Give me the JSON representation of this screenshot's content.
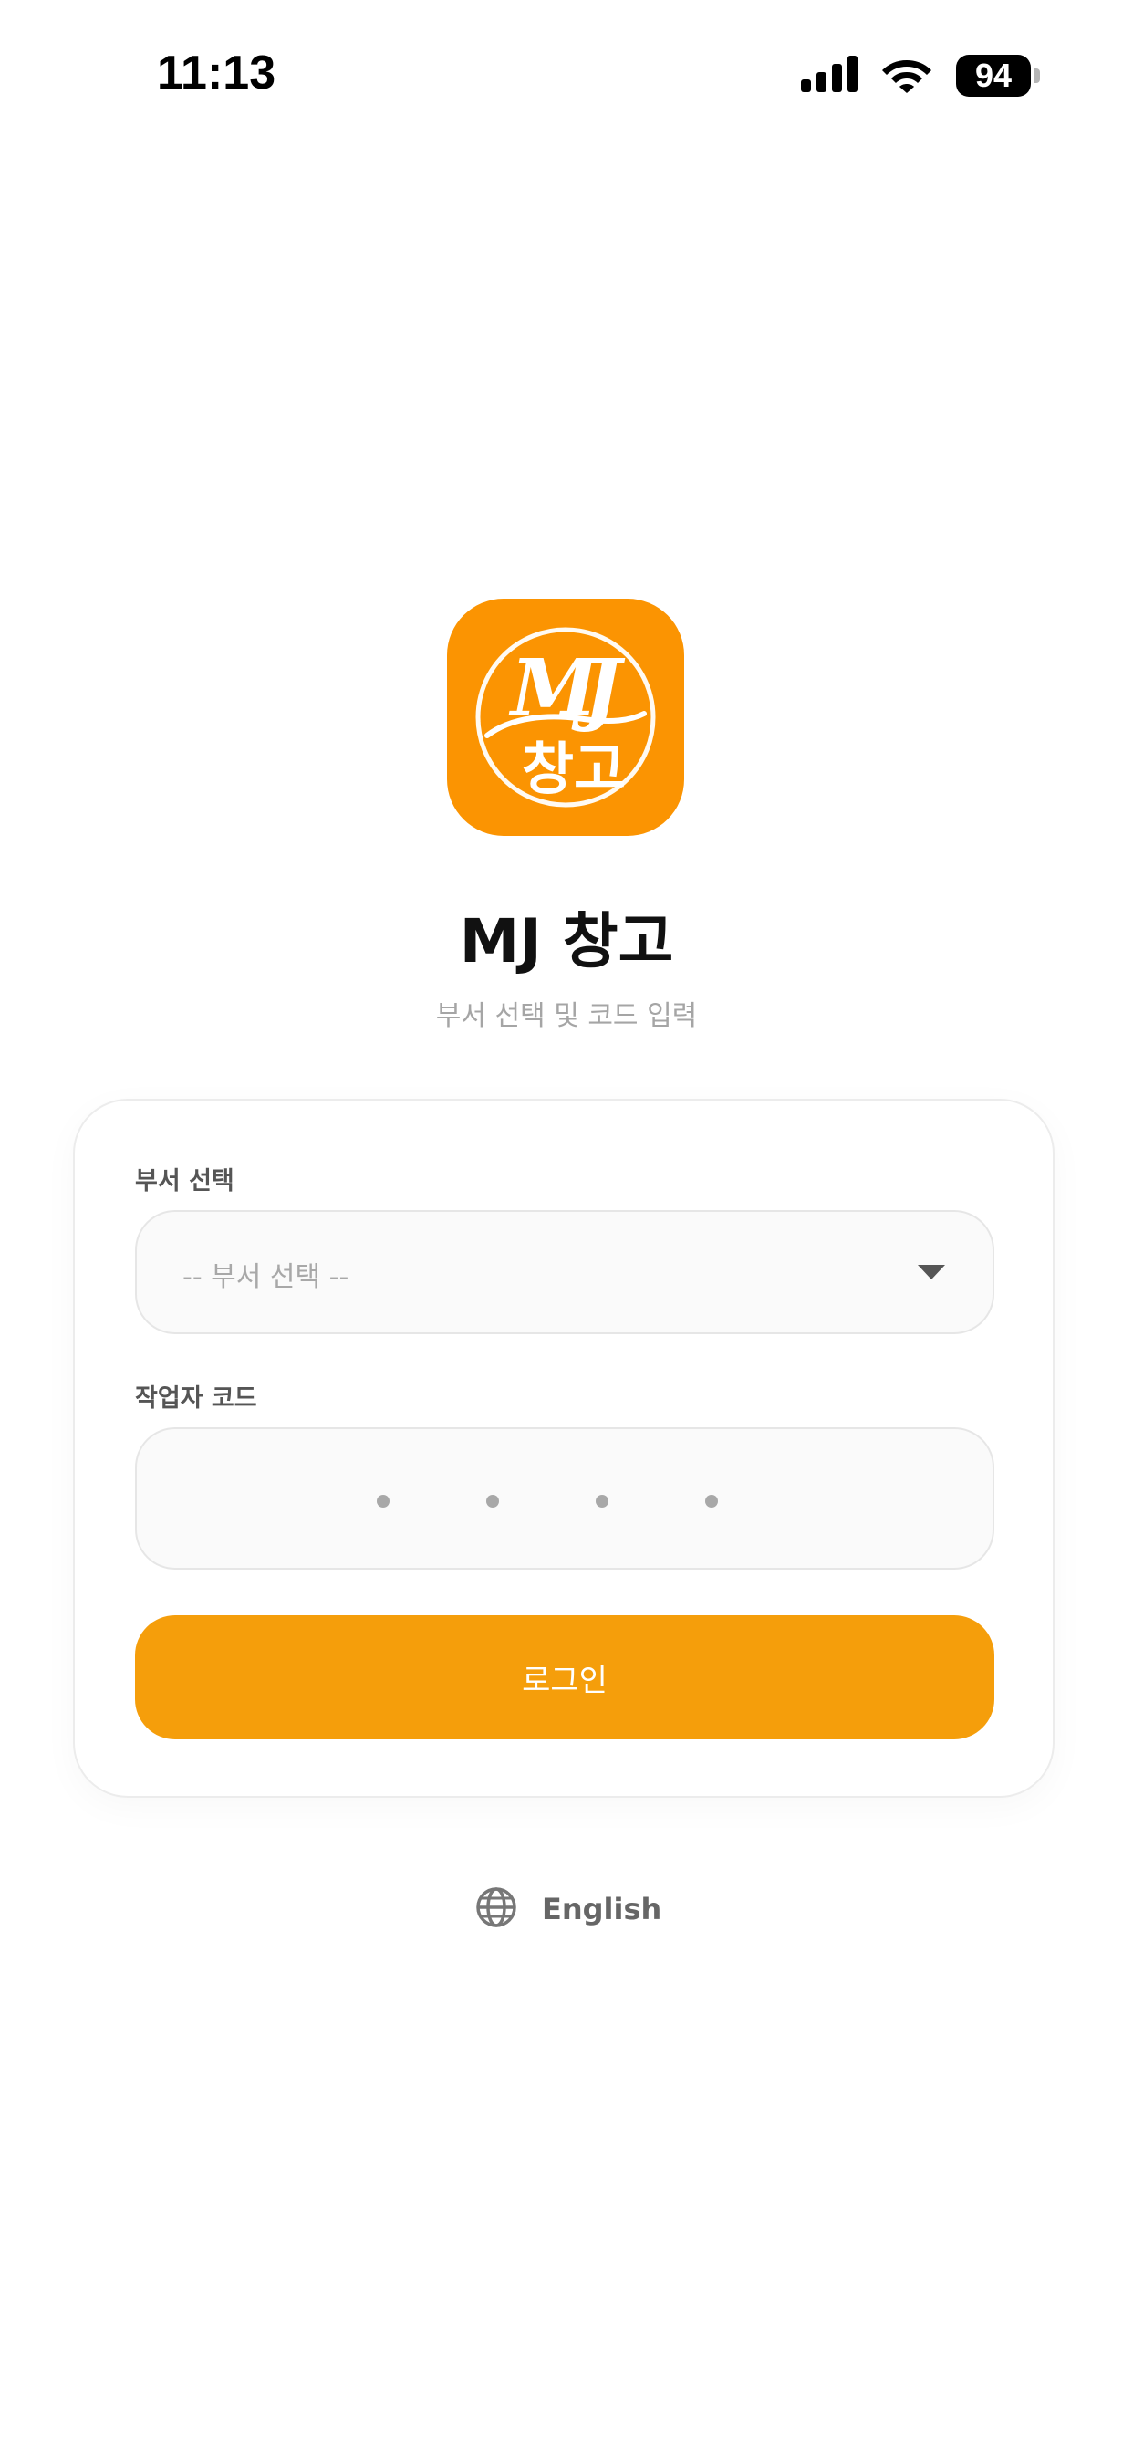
{
  "status_bar": {
    "time": "11:13",
    "battery": "94"
  },
  "app": {
    "title": "MJ 창고",
    "subtitle": "부서 선택 및 코드 입력",
    "logo_text": "MJ창고",
    "accent_color": "#f59e0b",
    "logo_color": "#fb9402"
  },
  "form": {
    "dept_label": "부서 선택",
    "dept_selected": "-- 부서 선택 --",
    "code_label": "작업자 코드",
    "code_length": 4,
    "login_label": "로그인"
  },
  "language": {
    "label": "English"
  }
}
